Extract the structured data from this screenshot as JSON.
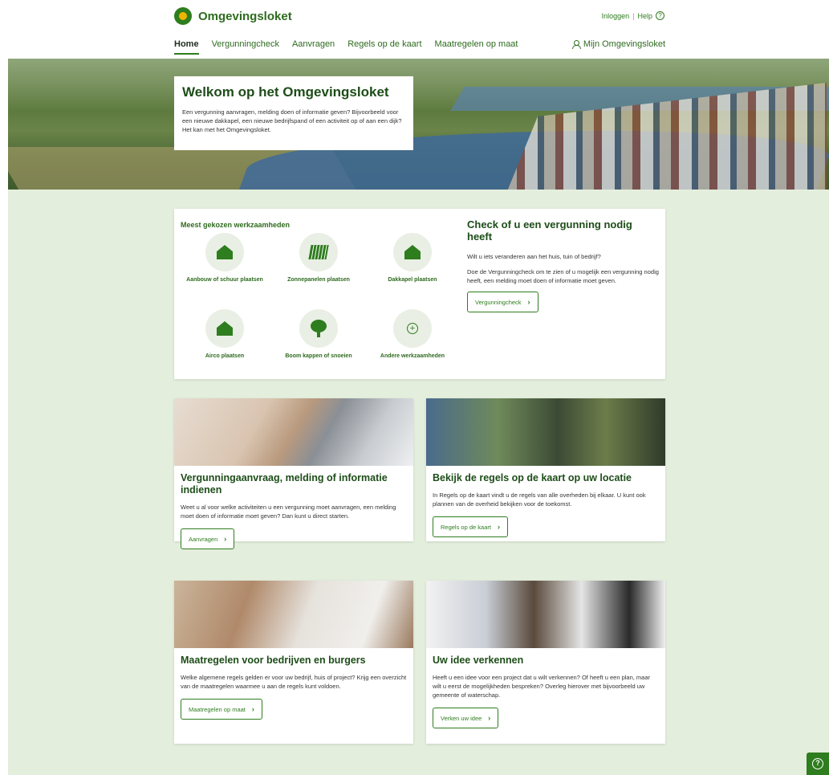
{
  "header": {
    "logo_text": "Omgevingsloket",
    "login_label": "Inloggen",
    "help_label": "Help",
    "nav": [
      "Home",
      "Vergunningcheck",
      "Aanvragen",
      "Regels op de kaart",
      "Maatregelen op maat"
    ],
    "account_label": "Mijn Omgevingsloket"
  },
  "hero": {
    "title": "Welkom op het Omgevingsloket",
    "text": "Een vergunning aanvragen, melding doen of informatie geven? Bijvoorbeeld voor een nieuwe dakkapel, een nieuwe bedrijfspand of een activiteit op of aan een dijk? Het kan met het Omgevingsloket."
  },
  "werkzaamheden": {
    "title": "Meest gekozen werkzaamheden",
    "items": [
      {
        "label": "Aanbouw of schuur plaatsen",
        "icon": "house-icon"
      },
      {
        "label": "Zonnepanelen plaatsen",
        "icon": "solar-panel-icon"
      },
      {
        "label": "Dakkapel plaatsen",
        "icon": "house-icon"
      },
      {
        "label": "Airco plaatsen",
        "icon": "house-icon"
      },
      {
        "label": "Boom kappen of snoeien",
        "icon": "tree-icon"
      },
      {
        "label": "Andere werkzaamheden",
        "icon": "plus-icon"
      }
    ]
  },
  "check": {
    "title": "Check of u een vergunning nodig heeft",
    "text1": "Wilt u iets veranderen aan het huis, tuin of bedrijf?",
    "text2": "Doe de Vergunningcheck om te zien of u mogelijk een vergunning nodig heeft, een melding moet doen of informatie moet geven.",
    "button": "Vergunningcheck"
  },
  "cards": [
    {
      "title": "Vergunningaanvraag, melding of informatie indienen",
      "text": "Weet u al voor welke activiteiten u een vergunning moet aanvragen, een melding moet doen of informatie moet geven? Dan kunt u direct starten.",
      "button": "Aanvragen"
    },
    {
      "title": "Bekijk de regels op de kaart op uw locatie",
      "text": "In Regels op de kaart vindt u de regels van alle overheden bij elkaar. U kunt ook plannen van de overheid bekijken voor de toekomst.",
      "button": "Regels op de kaart"
    },
    {
      "title": "Maatregelen voor bedrijven en burgers",
      "text": "Welke algemene regels gelden er voor uw bedrijf, huis of project? Krijg een overzicht van de maatregelen waarmee u aan de regels kunt voldoen.",
      "button": "Maatregelen op maat"
    },
    {
      "title": "Uw idee verkennen",
      "text": "Heeft u een idee voor een project dat u wilt verkennen? Of heeft u een plan, maar wilt u eerst de mogelijkheden bespreken? Overleg hierover met bijvoorbeeld uw gemeente of waterschap.",
      "button": "Verken uw idee"
    }
  ]
}
